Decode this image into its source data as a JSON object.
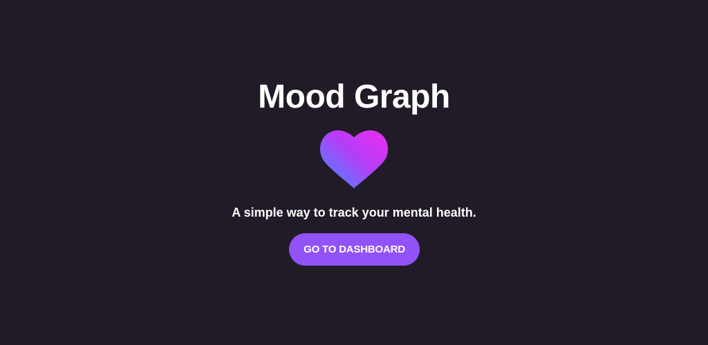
{
  "app": {
    "title": "Mood Graph",
    "tagline": "A simple way to track your mental health.",
    "cta_label": "GO TO DASHBOARD"
  },
  "icons": {
    "logo": "heart-icon"
  },
  "colors": {
    "background": "#211b27",
    "button": "#9152f8",
    "heart_gradient_start": "#5b7bff",
    "heart_gradient_end": "#ee2cf1",
    "text": "#ffffff"
  }
}
